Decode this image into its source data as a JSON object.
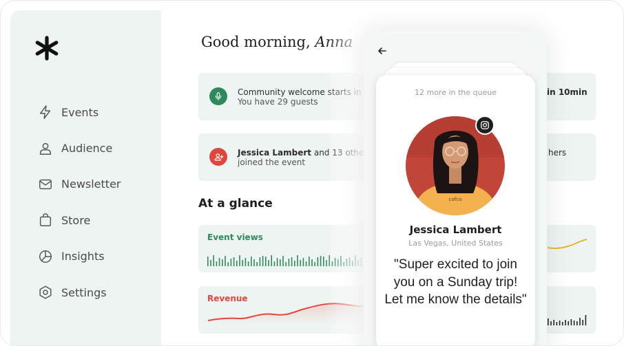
{
  "sidebar": {
    "items": [
      {
        "label": "Events",
        "icon": "bolt-icon"
      },
      {
        "label": "Audience",
        "icon": "user-icon"
      },
      {
        "label": "Newsletter",
        "icon": "mail-icon"
      },
      {
        "label": "Store",
        "icon": "bag-icon"
      },
      {
        "label": "Insights",
        "icon": "pie-chart-icon"
      },
      {
        "label": "Settings",
        "icon": "settings-icon"
      }
    ]
  },
  "header": {
    "greeting": "Good morning, ",
    "name": "Anna"
  },
  "notifications": [
    {
      "icon": "microphone-icon",
      "color": "#2f8a5b",
      "text_prefix": "Community welcome starts in ",
      "text_bold": "10min",
      "sub": "You have 29 guests"
    },
    {
      "icon": "user-add-icon",
      "color": "#e0473c",
      "text_bold": "Jessica Lambert",
      "text_suffix": " and 13 others",
      "sub": "joined the event"
    }
  ],
  "right_fragments": {
    "n1": "in 10min",
    "n2": "hers"
  },
  "glance": {
    "title": "At a glance",
    "event_views_label": "Event views",
    "revenue_label": "Revenue",
    "event_views_color": "#2f8a5b",
    "revenue_color": "#e0473c",
    "accent_yellow": "#e8b730"
  },
  "overlay": {
    "queue_text": "12 more in the queue",
    "name": "Jessica Lambert",
    "location": "Las Vegas, United States",
    "quote": "\"Super excited to join you on a Sunday trip! Let me know the details\"",
    "shirt_text": "cofco"
  }
}
